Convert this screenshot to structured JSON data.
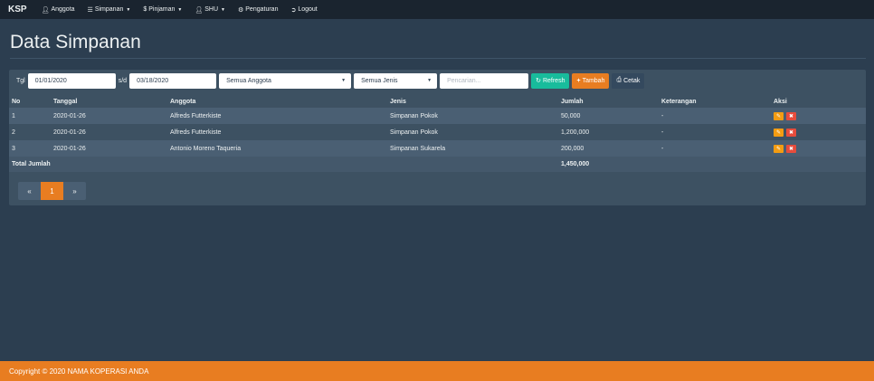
{
  "navbar": {
    "brand": "KSP",
    "items": [
      {
        "label": "Anggota",
        "icon": "user-icon",
        "dropdown": false
      },
      {
        "label": "Simpanan",
        "icon": "list-icon",
        "dropdown": true
      },
      {
        "label": "Pinjaman",
        "icon": "dollar-icon",
        "dropdown": true
      },
      {
        "label": "SHU",
        "icon": "user-icon",
        "dropdown": true
      },
      {
        "label": "Pengaturan",
        "icon": "gear-icon",
        "dropdown": false
      },
      {
        "label": "Logout",
        "icon": "logout-icon",
        "dropdown": false
      }
    ]
  },
  "page": {
    "title": "Data Simpanan"
  },
  "filters": {
    "tgl_label": "Tgl",
    "date_from": "01/01/2020",
    "sd_label": "s/d",
    "date_to": "03/18/2020",
    "anggota_select": "Semua Anggota",
    "jenis_select": "Semua Jenis",
    "search_placeholder": "Pencarian...",
    "refresh_label": "Refresh",
    "tambah_label": "Tambah",
    "cetak_label": "Cetak"
  },
  "table": {
    "headers": {
      "no": "No",
      "tanggal": "Tanggal",
      "anggota": "Anggota",
      "jenis": "Jenis",
      "jumlah": "Jumlah",
      "keterangan": "Keterangan",
      "aksi": "Aksi"
    },
    "rows": [
      {
        "no": "1",
        "tanggal": "2020-01-26",
        "anggota": "Alfreds Futterkiste",
        "jenis": "Simpanan Pokok",
        "jumlah": "50,000",
        "keterangan": "-"
      },
      {
        "no": "2",
        "tanggal": "2020-01-26",
        "anggota": "Alfreds Futterkiste",
        "jenis": "Simpanan Pokok",
        "jumlah": "1,200,000",
        "keterangan": "-"
      },
      {
        "no": "3",
        "tanggal": "2020-01-26",
        "anggota": "Antonio Moreno Taqueria",
        "jenis": "Simpanan Sukarela",
        "jumlah": "200,000",
        "keterangan": "-"
      }
    ],
    "total_label": "Total Jumlah",
    "total_value": "1,450,000"
  },
  "pagination": {
    "prev": "«",
    "current": "1",
    "next": "»"
  },
  "footer": {
    "text": "Copyright © 2020 NAMA KOPERASI ANDA"
  },
  "colors": {
    "background": "#2c3e50",
    "navbar": "#1a242f",
    "accent": "#e87d21",
    "success": "#18bc9c",
    "edit": "#f39c12",
    "delete": "#e74c3c"
  }
}
